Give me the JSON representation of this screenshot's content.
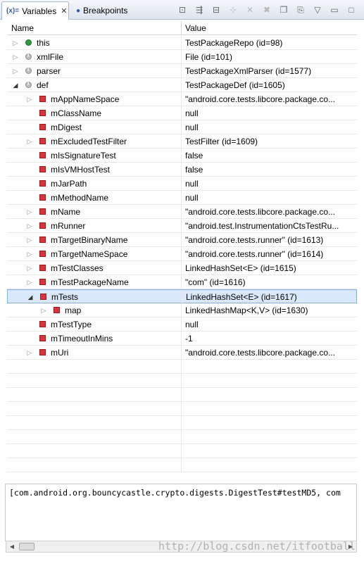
{
  "tabs": [
    {
      "label": "Variables",
      "icon": "variables-icon",
      "active": true
    },
    {
      "label": "Breakpoints",
      "icon": "breakpoints-icon",
      "active": false
    }
  ],
  "toolbar": [
    {
      "icon": "show-type-names-icon",
      "symbol": "⊡",
      "enabled": true
    },
    {
      "icon": "show-logical-structure-icon",
      "symbol": "⇶",
      "enabled": true
    },
    {
      "icon": "collapse-all-icon",
      "symbol": "⊟",
      "enabled": true
    },
    {
      "icon": "new-watch-icon",
      "symbol": "⊹",
      "enabled": false
    },
    {
      "icon": "remove-icon",
      "symbol": "✕",
      "enabled": false
    },
    {
      "icon": "remove-all-icon",
      "symbol": "✖",
      "enabled": false
    },
    {
      "icon": "layout-icon",
      "symbol": "❐",
      "enabled": true
    },
    {
      "icon": "pin-icon",
      "symbol": "⎘",
      "enabled": true
    },
    {
      "icon": "view-menu-icon",
      "symbol": "▽",
      "enabled": true
    },
    {
      "icon": "minimize-icon",
      "symbol": "▭",
      "enabled": true
    },
    {
      "icon": "maximize-icon",
      "symbol": "□",
      "enabled": true
    }
  ],
  "columns": {
    "name": "Name",
    "value": "Value"
  },
  "rows": [
    {
      "name": "this",
      "value": "TestPackageRepo  (id=98)",
      "depth": 0,
      "twisty": "closed",
      "icon": "green"
    },
    {
      "name": "xmlFile",
      "value": "File  (id=101)",
      "depth": 0,
      "twisty": "closed",
      "icon": "gray"
    },
    {
      "name": "parser",
      "value": "TestPackageXmlParser  (id=1577)",
      "depth": 0,
      "twisty": "closed",
      "icon": "gray"
    },
    {
      "name": "def",
      "value": "TestPackageDef  (id=1605)",
      "depth": 0,
      "twisty": "open",
      "icon": "gray"
    },
    {
      "name": "mAppNameSpace",
      "value": "\"android.core.tests.libcore.package.co...",
      "depth": 1,
      "twisty": "closed",
      "icon": "red"
    },
    {
      "name": "mClassName",
      "value": "null",
      "depth": 1,
      "twisty": "none",
      "icon": "red"
    },
    {
      "name": "mDigest",
      "value": "null",
      "depth": 1,
      "twisty": "none",
      "icon": "red"
    },
    {
      "name": "mExcludedTestFilter",
      "value": "TestFilter  (id=1609)",
      "depth": 1,
      "twisty": "closed",
      "icon": "red"
    },
    {
      "name": "mIsSignatureTest",
      "value": "false",
      "depth": 1,
      "twisty": "none",
      "icon": "red"
    },
    {
      "name": "mIsVMHostTest",
      "value": "false",
      "depth": 1,
      "twisty": "none",
      "icon": "red"
    },
    {
      "name": "mJarPath",
      "value": "null",
      "depth": 1,
      "twisty": "none",
      "icon": "red"
    },
    {
      "name": "mMethodName",
      "value": "null",
      "depth": 1,
      "twisty": "none",
      "icon": "red"
    },
    {
      "name": "mName",
      "value": "\"android.core.tests.libcore.package.co...",
      "depth": 1,
      "twisty": "closed",
      "icon": "red"
    },
    {
      "name": "mRunner",
      "value": "\"android.test.InstrumentationCtsTestRu...",
      "depth": 1,
      "twisty": "closed",
      "icon": "red"
    },
    {
      "name": "mTargetBinaryName",
      "value": "\"android.core.tests.runner\"  (id=1613)",
      "depth": 1,
      "twisty": "closed",
      "icon": "red"
    },
    {
      "name": "mTargetNameSpace",
      "value": "\"android.core.tests.runner\"  (id=1614)",
      "depth": 1,
      "twisty": "closed",
      "icon": "red"
    },
    {
      "name": "mTestClasses",
      "value": "LinkedHashSet<E>  (id=1615)",
      "depth": 1,
      "twisty": "closed",
      "icon": "red"
    },
    {
      "name": "mTestPackageName",
      "value": "\"com\"  (id=1616)",
      "depth": 1,
      "twisty": "closed",
      "icon": "red"
    },
    {
      "name": "mTests",
      "value": "LinkedHashSet<E>  (id=1617)",
      "depth": 1,
      "twisty": "open",
      "icon": "red",
      "selected": true
    },
    {
      "name": "map",
      "value": "LinkedHashMap<K,V>  (id=1630)",
      "depth": 2,
      "twisty": "closed",
      "icon": "red"
    },
    {
      "name": "mTestType",
      "value": "null",
      "depth": 1,
      "twisty": "none",
      "icon": "red"
    },
    {
      "name": "mTimeoutInMins",
      "value": "-1",
      "depth": 1,
      "twisty": "none",
      "icon": "red"
    },
    {
      "name": "mUri",
      "value": "\"android.core.tests.libcore.package.co...",
      "depth": 1,
      "twisty": "closed",
      "icon": "red"
    }
  ],
  "detail_text": "[com.android.org.bouncycastle.crypto.digests.DigestTest#testMD5, com",
  "watermark": "http://blog.csdn.net/itfootball"
}
